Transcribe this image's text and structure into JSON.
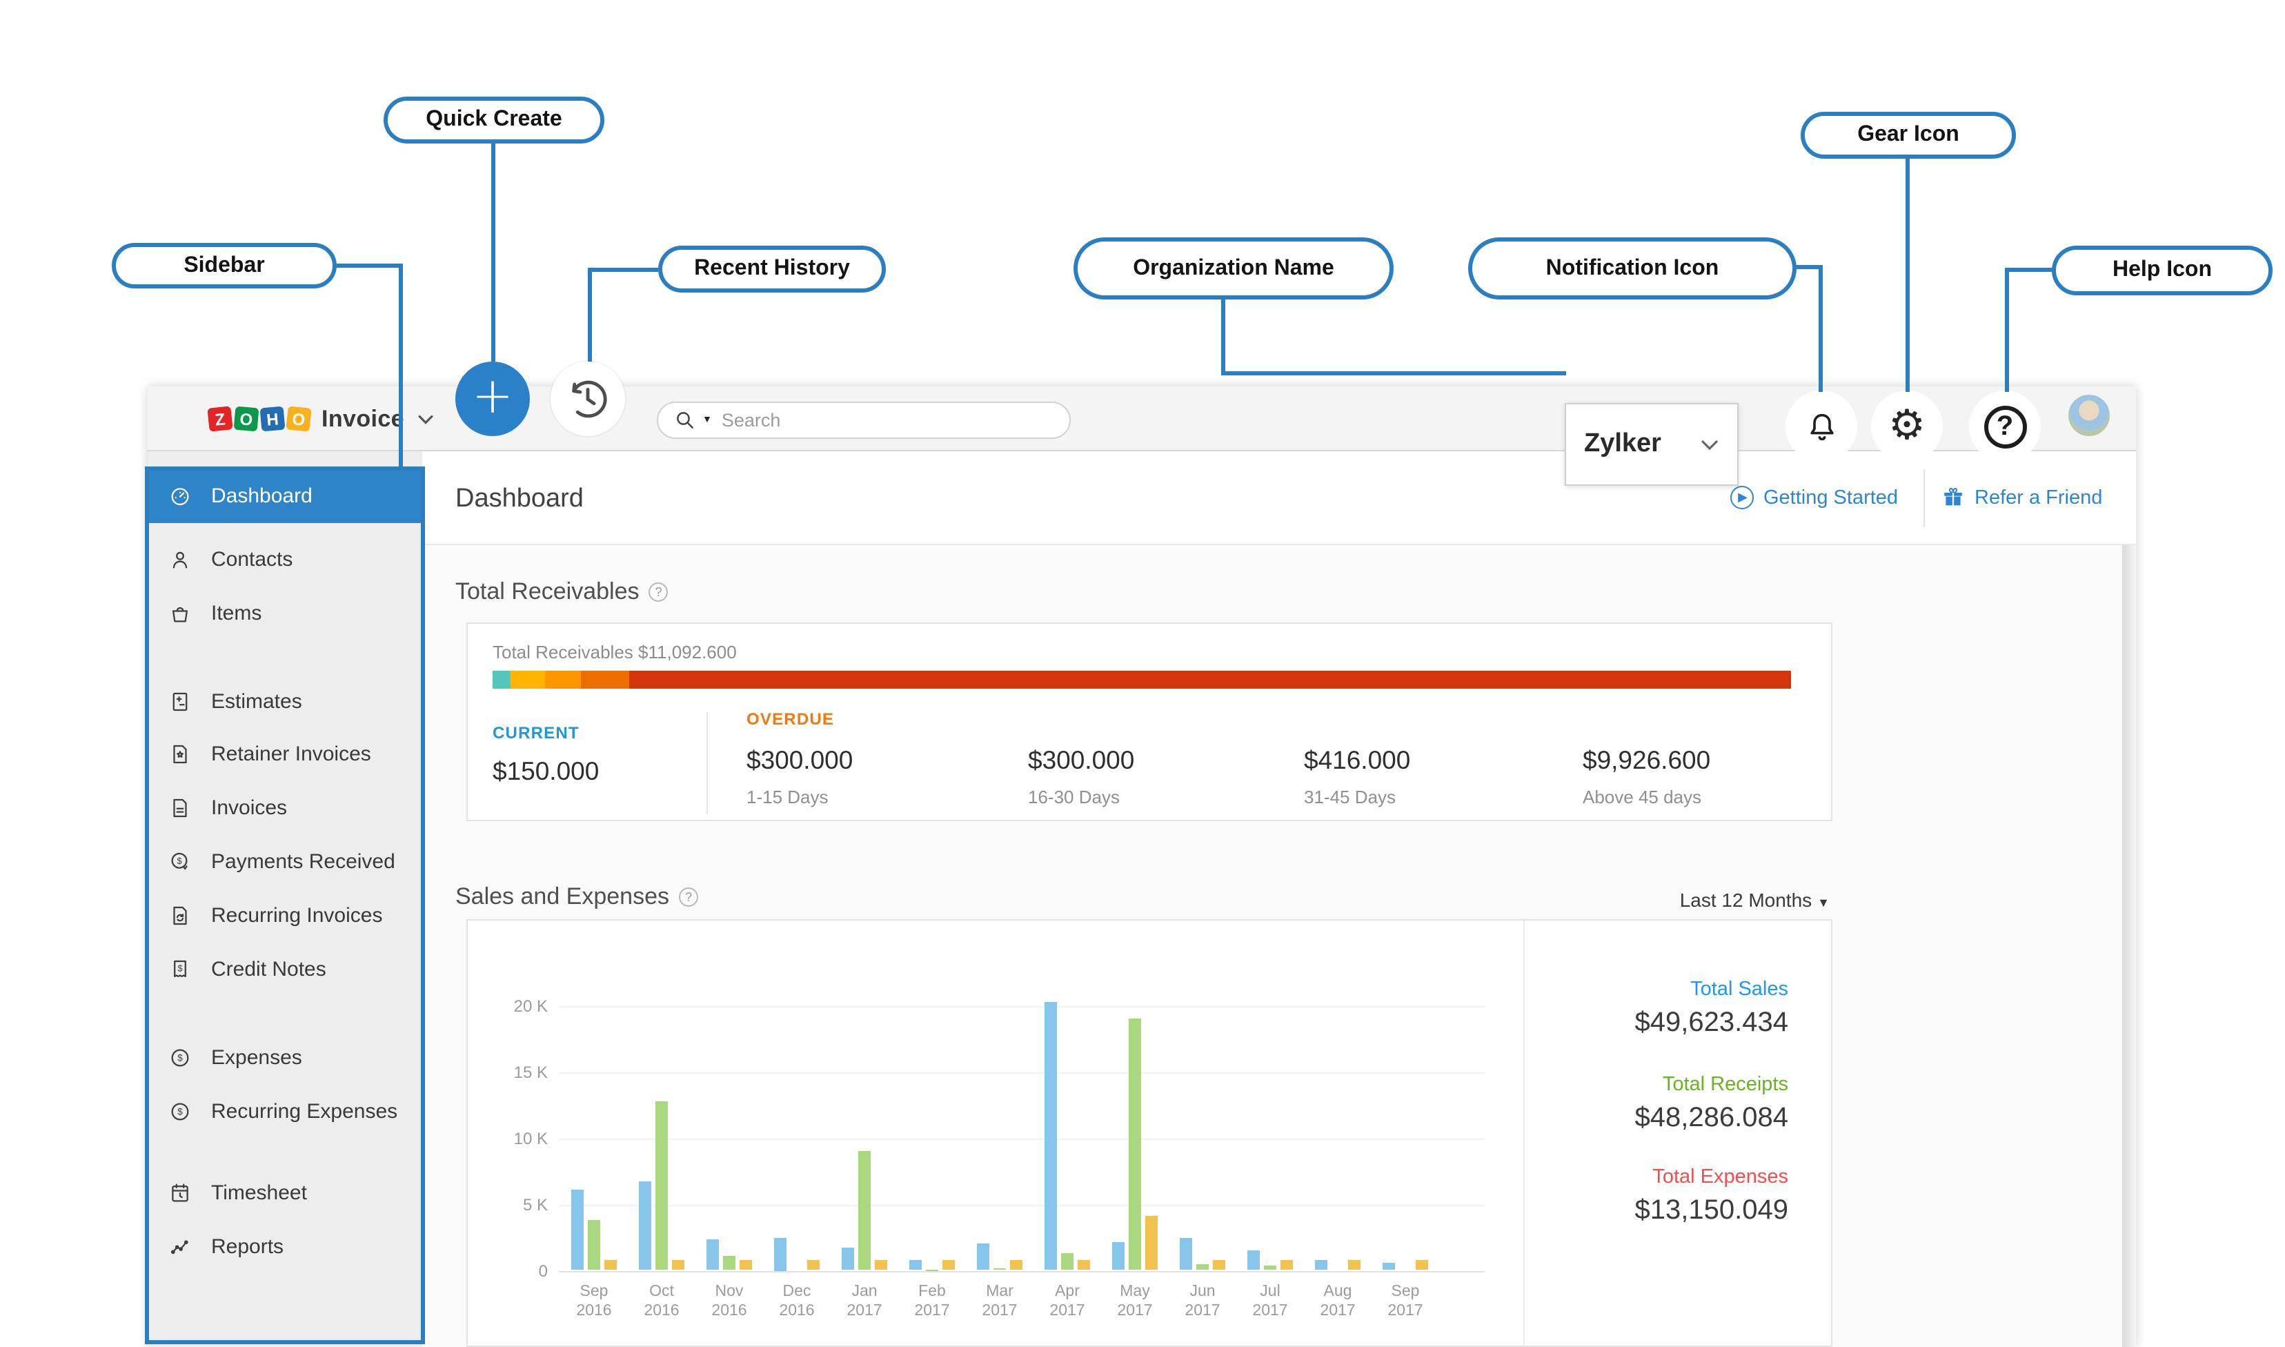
{
  "annotations": {
    "accent_color": "#2b7fc1",
    "quick_create": {
      "label": "Quick Create"
    },
    "recent_history": {
      "label": "Recent History"
    },
    "sidebar": {
      "label": "Sidebar"
    },
    "organization_name": {
      "label": "Organization Name"
    },
    "notification_icon": {
      "label": "Notification Icon"
    },
    "gear_icon": {
      "label": "Gear Icon"
    },
    "help_icon": {
      "label": "Help Icon"
    }
  },
  "topbar": {
    "logo": {
      "letters": [
        "Z",
        "O",
        "H",
        "O"
      ],
      "letter_colors": [
        "#e42527",
        "#089949",
        "#226db4",
        "#f9b21d"
      ],
      "product": "Invoice"
    },
    "search": {
      "placeholder": "Search",
      "icon": "search-icon"
    },
    "organization": {
      "name": "Zylker"
    },
    "icons": {
      "quick_create": "plus-icon",
      "recent_history": "clock-history-icon",
      "notifications": "bell-icon",
      "settings": "gear-icon",
      "help": "question-icon",
      "profile": "user-avatar"
    }
  },
  "sidebar": {
    "active_color": "#2e84c6",
    "items": [
      {
        "label": "Dashboard",
        "icon": "dashboard-icon",
        "active": true
      },
      {
        "label": "Contacts",
        "icon": "contacts-icon"
      },
      {
        "label": "Items",
        "icon": "items-icon"
      },
      {
        "label": "Estimates",
        "icon": "estimates-icon"
      },
      {
        "label": "Retainer Invoices",
        "icon": "retainer-invoices-icon"
      },
      {
        "label": "Invoices",
        "icon": "invoices-icon"
      },
      {
        "label": "Payments Received",
        "icon": "payments-received-icon"
      },
      {
        "label": "Recurring Invoices",
        "icon": "recurring-invoices-icon"
      },
      {
        "label": "Credit Notes",
        "icon": "credit-notes-icon"
      },
      {
        "label": "Expenses",
        "icon": "expenses-icon"
      },
      {
        "label": "Recurring Expenses",
        "icon": "recurring-expenses-icon"
      },
      {
        "label": "Timesheet",
        "icon": "timesheet-icon"
      },
      {
        "label": "Reports",
        "icon": "reports-icon"
      }
    ]
  },
  "page_header": {
    "title": "Dashboard",
    "links": [
      {
        "label": "Getting Started",
        "icon": "play-icon"
      },
      {
        "label": "Refer a Friend",
        "icon": "gift-icon"
      }
    ]
  },
  "receivables": {
    "section_title": "Total Receivables",
    "summary_label": "Total Receivables",
    "summary_value": "$11,092.600",
    "bar_segments": [
      {
        "name": "current",
        "amount": 150.0,
        "color": "#56c5bd"
      },
      {
        "name": "overdue-1-15-days",
        "amount": 300.0,
        "color": "#ffb400"
      },
      {
        "name": "overdue-16-30-days",
        "amount": 300.0,
        "color": "#fc9700"
      },
      {
        "name": "overdue-31-45-days",
        "amount": 416.0,
        "color": "#ee6d00"
      },
      {
        "name": "overdue-above-45-days",
        "amount": 9926.6,
        "color": "#d2340c"
      }
    ],
    "current": {
      "label": "CURRENT",
      "value": "$150.000",
      "color": "#2196d8"
    },
    "overdue": {
      "label": "OVERDUE",
      "color": "#f47810",
      "columns": [
        {
          "value": "$300.000",
          "period": "1-15 Days"
        },
        {
          "value": "$300.000",
          "period": "16-30 Days"
        },
        {
          "value": "$416.000",
          "period": "31-45 Days"
        },
        {
          "value": "$9,926.600",
          "period": "Above 45 days"
        }
      ]
    }
  },
  "sales_expenses": {
    "section_title": "Sales and Expenses",
    "range_label": "Last 12 Months",
    "totals": [
      {
        "label": "Total Sales",
        "value": "$49,623.434",
        "color": "#2196f3"
      },
      {
        "label": "Total Receipts",
        "value": "$48,286.084",
        "color": "#67b321"
      },
      {
        "label": "Total Expenses",
        "value": "$13,150.049",
        "color": "#f24e4e"
      }
    ]
  },
  "chart_data": {
    "type": "bar",
    "title": "Sales and Expenses",
    "xlabel": "",
    "ylabel": "",
    "ylim": [
      0,
      20000
    ],
    "yticks": [
      "0",
      "5 K",
      "10 K",
      "15 K",
      "20 K"
    ],
    "grid": true,
    "legend": false,
    "categories": [
      "Sep 2016",
      "Oct 2016",
      "Nov 2016",
      "Dec 2016",
      "Jan 2017",
      "Feb 2017",
      "Mar 2017",
      "Apr 2017",
      "May 2017",
      "Jun 2017",
      "Jul 2017",
      "Aug 2017",
      "Sep 2017"
    ],
    "series": [
      {
        "name": "Sales",
        "color": "#87c6ec",
        "values": [
          6100,
          6700,
          2300,
          2500,
          1700,
          800,
          2000,
          20300,
          2100,
          2400,
          1500,
          750,
          600
        ]
      },
      {
        "name": "Receipts",
        "color": "#a9d87e",
        "values": [
          3800,
          12800,
          1100,
          0,
          9000,
          100,
          150,
          1300,
          19000,
          500,
          400,
          0,
          0
        ]
      },
      {
        "name": "Expenses",
        "color": "#f1c250",
        "values": [
          800,
          800,
          800,
          800,
          800,
          800,
          800,
          750,
          4100,
          750,
          750,
          750,
          750
        ]
      }
    ]
  }
}
